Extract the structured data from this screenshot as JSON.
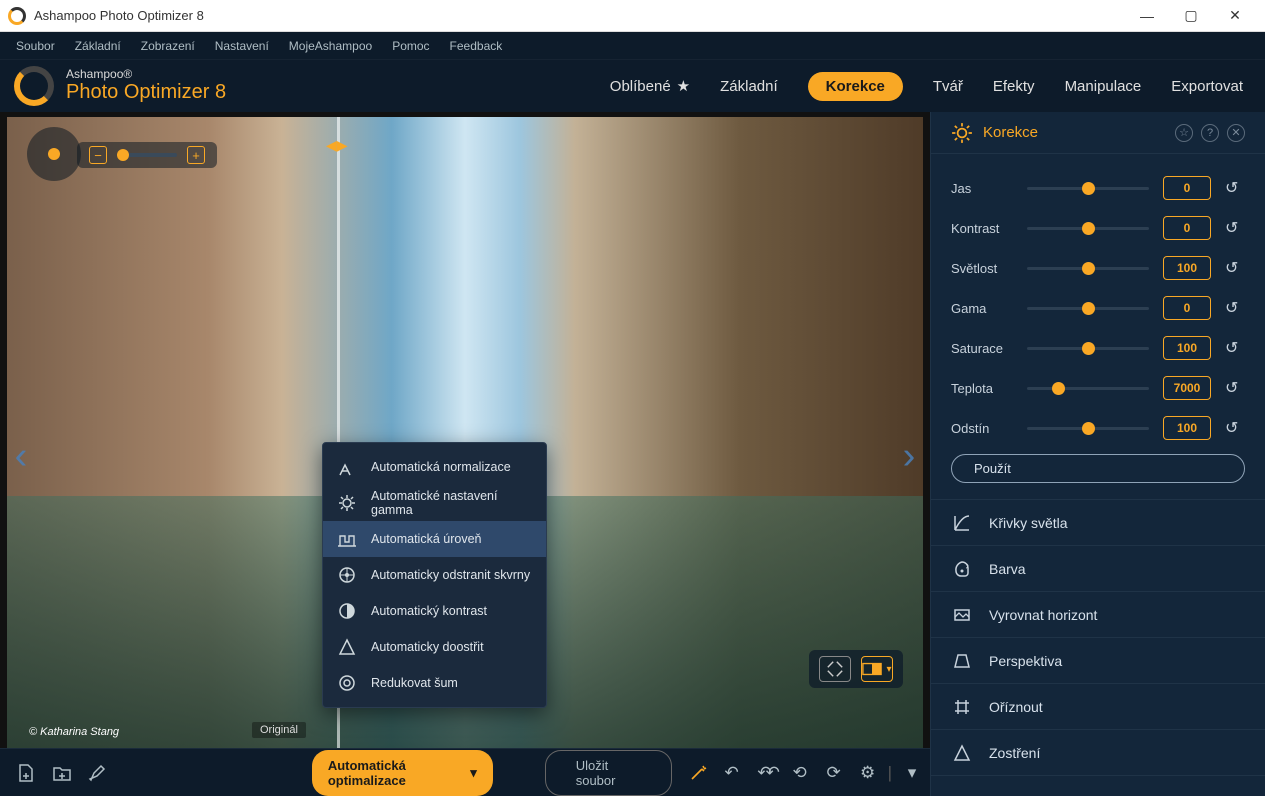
{
  "window_title": "Ashampoo Photo Optimizer 8",
  "menubar": [
    "Soubor",
    "Základní",
    "Zobrazení",
    "Nastavení",
    "MojeAshampoo",
    "Pomoc",
    "Feedback"
  ],
  "brand": {
    "line1": "Ashampoo®",
    "line2": "Photo Optimizer 8"
  },
  "nav": {
    "items": [
      "Oblíbené",
      "Základní",
      "Korekce",
      "Tvář",
      "Efekty",
      "Manipulace",
      "Exportovat"
    ],
    "active": "Korekce"
  },
  "image": {
    "original_label": "Originál",
    "watermark": "© Katharina Stang"
  },
  "popup": {
    "items": [
      {
        "label": "Automatická normalizace",
        "svg": "<path d='M3 18 L8 8 L13 18 M5 14 L11 14' fill='none' stroke='currentColor' stroke-width='1.5'/>"
      },
      {
        "label": "Automatické nastavení gamma",
        "svg": "<circle cx='10' cy='10' r='4' fill='none' stroke='currentColor' stroke-width='1.5'/><g stroke='currentColor' stroke-width='1.5'><line x1='10' y1='2' x2='10' y2='5'/><line x1='10' y1='15' x2='10' y2='18'/><line x1='2' y1='10' x2='5' y2='10'/><line x1='15' y1='10' x2='18' y2='10'/><line x1='4' y1='4' x2='6' y2='6'/><line x1='14' y1='14' x2='16' y2='16'/><line x1='14' y1='6' x2='16' y2='4'/><line x1='4' y1='16' x2='6' y2='14'/></g>"
      },
      {
        "label": "Automatická úroveň",
        "svg": "<path d='M3 17 L3 7 L8 7 L8 13 L12 13 L12 7 L17 7 L17 17' fill='none' stroke='currentColor' stroke-width='1.4'/><line x1='1' y1='17' x2='19' y2='17' stroke='currentColor' stroke-width='1.4'/>"
      },
      {
        "label": "Automaticky odstranit skvrny",
        "svg": "<circle cx='10' cy='10' r='7' fill='none' stroke='currentColor' stroke-width='1.5'/><circle cx='10' cy='10' r='2' fill='currentColor'/><line x1='10' y1='3' x2='10' y2='17' stroke='currentColor'/><line x1='3' y1='10' x2='17' y2='10' stroke='currentColor'/>"
      },
      {
        "label": "Automatický kontrast",
        "svg": "<circle cx='10' cy='10' r='7' fill='none' stroke='currentColor' stroke-width='1.5'/><path d='M10 3 A7 7 0 0 1 10 17 Z' fill='currentColor'/>"
      },
      {
        "label": "Automaticky doostřit",
        "svg": "<path d='M10 3 L17 17 L3 17 Z' fill='none' stroke='currentColor' stroke-width='1.5'/>"
      },
      {
        "label": "Redukovat šum",
        "svg": "<circle cx='10' cy='10' r='7' fill='none' stroke='currentColor' stroke-width='1.5'/><circle cx='10' cy='10' r='3' fill='none' stroke='currentColor' stroke-width='1.5'/>"
      }
    ],
    "selected": 2
  },
  "auto_button": "Automatická optimalizace",
  "save_button": "Uložit soubor",
  "panel": {
    "title": "Korekce",
    "sliders": [
      {
        "label": "Jas",
        "value": "0",
        "pos": 50
      },
      {
        "label": "Kontrast",
        "value": "0",
        "pos": 50
      },
      {
        "label": "Světlost",
        "value": "100",
        "pos": 50
      },
      {
        "label": "Gama",
        "value": "0",
        "pos": 50
      },
      {
        "label": "Saturace",
        "value": "100",
        "pos": 50
      },
      {
        "label": "Teplota",
        "value": "7000",
        "pos": 25
      },
      {
        "label": "Odstín",
        "value": "100",
        "pos": 50
      }
    ],
    "apply": "Použít",
    "sections": [
      {
        "label": "Křivky světla",
        "svg": "<path d='M3 17 L3 3 M3 17 L17 17 M3 17 Q10 3 17 3' fill='none' stroke='currentColor' stroke-width='1.5'/>"
      },
      {
        "label": "Barva",
        "svg": "<path d='M10 3 A6 6 0 0 1 16 9 L16 14 A3 3 0 0 1 13 17 L9 17 A5 5 0 0 1 4 12 A8 8 0 0 1 10 3 Z' fill='none' stroke='currentColor' stroke-width='1.5'/><circle cx='10' cy='12' r='1.5' fill='currentColor'/><path d='M14 5 A2 2 0 0 1 14 9' fill='none' stroke='currentColor'/>"
      },
      {
        "label": "Vyrovnat horizont",
        "svg": "<rect x='3' y='5' width='14' height='10' fill='none' stroke='currentColor' stroke-width='1.5'/><path d='M3 12 L7 8 L11 12 L14 9 L17 12' fill='none' stroke='currentColor' stroke-width='1.3'/>"
      },
      {
        "label": "Perspektiva",
        "svg": "<path d='M6 4 L14 4 L17 16 L3 16 Z' fill='none' stroke='currentColor' stroke-width='1.5'/>"
      },
      {
        "label": "Oříznout",
        "svg": "<path d='M6 3 L6 17 M3 6 L17 6 M14 3 L14 17 M3 14 L17 14' stroke='currentColor' stroke-width='1.5' fill='none'/>"
      },
      {
        "label": "Zostření",
        "svg": "<path d='M10 3 L17 17 L3 17 Z' fill='none' stroke='currentColor' stroke-width='1.5'/>"
      }
    ]
  }
}
